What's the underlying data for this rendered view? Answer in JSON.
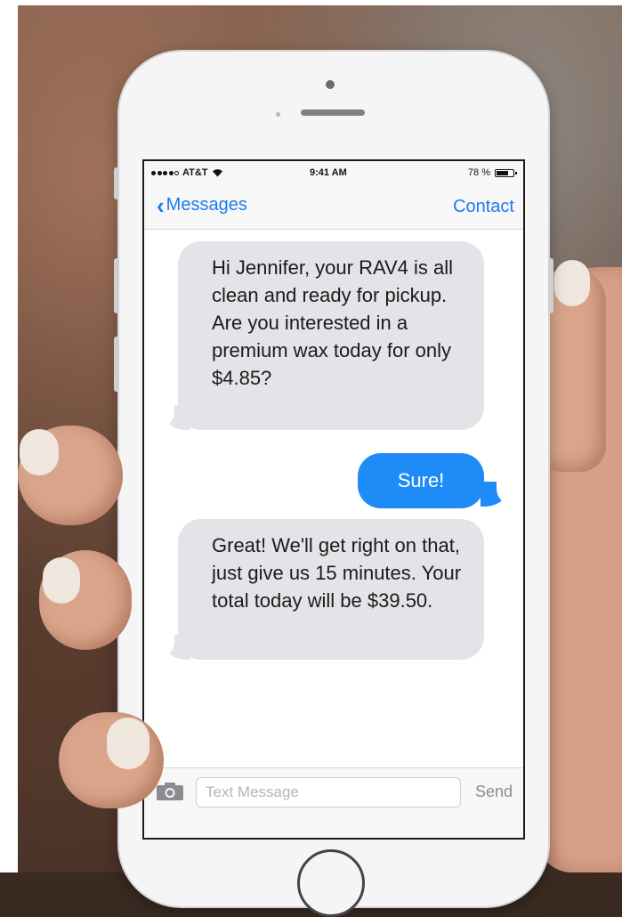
{
  "statusbar": {
    "carrier": "AT&T",
    "time": "9:41 AM",
    "battery_text": "78 %",
    "battery_level": 0.78,
    "signal_bars_filled": 4,
    "signal_bars_total": 5
  },
  "navbar": {
    "back_label": "Messages",
    "contact_label": "Contact"
  },
  "messages": [
    {
      "direction": "incoming",
      "text": "Hi Jennifer, your RAV4 is all clean and ready for pickup. Are you interested in a premium wax today for only $4.85?"
    },
    {
      "direction": "outgoing",
      "text": "Sure!"
    },
    {
      "direction": "incoming",
      "text": "Great! We'll get right on that, just give us 15 minutes. Your total today will be $39.50."
    }
  ],
  "compose": {
    "placeholder": "Text Message",
    "value": "",
    "send_label": "Send"
  },
  "icons": {
    "back": "chevron-left-icon",
    "camera": "camera-icon",
    "wifi": "wifi-icon",
    "battery": "battery-icon"
  },
  "colors": {
    "accent": "#1a7cf0",
    "outgoing_bubble": "#1f8bf7",
    "incoming_bubble": "#e4e4e8"
  }
}
